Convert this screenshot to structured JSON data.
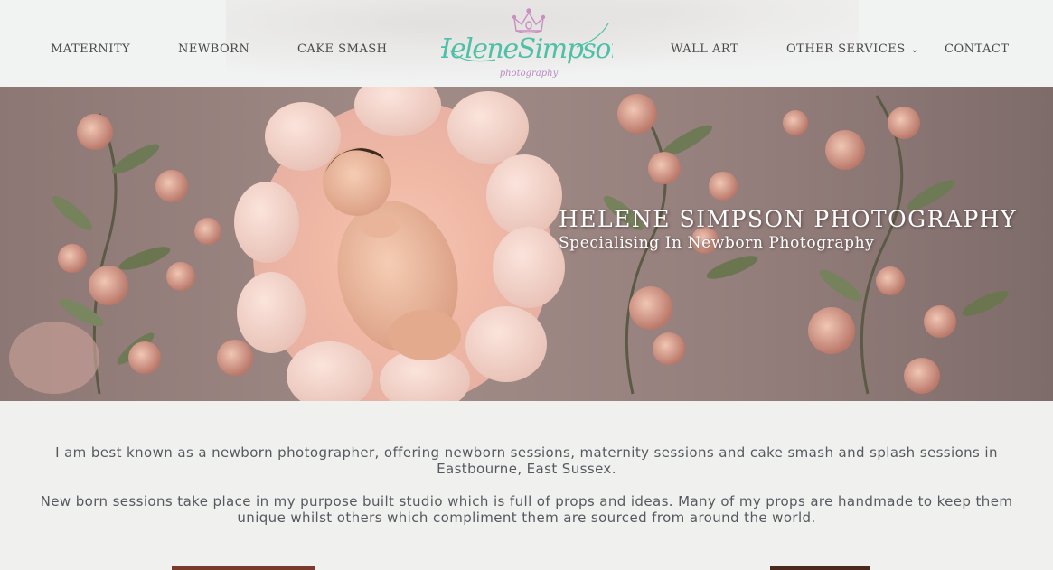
{
  "nav": {
    "left": [
      {
        "label": "MATERNITY"
      },
      {
        "label": "NEWBORN"
      },
      {
        "label": "CAKE SMASH"
      }
    ],
    "right": [
      {
        "label": "WALL ART"
      },
      {
        "label": "OTHER SERVICES",
        "has_dropdown": true
      },
      {
        "label": "CONTACT"
      }
    ]
  },
  "logo": {
    "name": "HeleneSimpson",
    "tagline": "photography",
    "colors": {
      "script": "#4fc0a8",
      "crown": "#c98fc0",
      "tagline": "#b98ac4"
    }
  },
  "hero": {
    "title": "HELENE SIMPSON PHOTOGRAPHY",
    "subtitle": "Specialising In Newborn Photography"
  },
  "intro": {
    "paragraph_1": "I am best known as a newborn photographer, offering newborn sessions, maternity sessions and cake smash and splash sessions in Eastbourne, East Sussex.",
    "paragraph_2": "New born sessions take place in my purpose built studio which is full of props and ideas. Many of my props are handmade to keep them unique whilst others which compliment them are sourced from around the world."
  },
  "colors": {
    "background": "#f0f0ee",
    "header_bg": "#f1f2f2",
    "nav_text": "#4a4a4a",
    "body_text": "#555a60",
    "hero_overlay_text": "#ffffff"
  }
}
